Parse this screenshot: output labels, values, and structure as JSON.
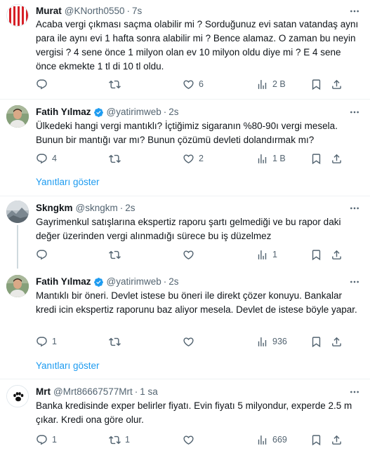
{
  "tweets": [
    {
      "name": "Murat",
      "handle": "@KNorth0550",
      "time": "7s",
      "verified": false,
      "text": "Acaba vergi çıkması saçma olabilir mi ? Sorduğunuz evi satan vatandaş aynı para ile aynı evi 1 hafta sonra alabilir mi ? Bence alamaz. O zaman bu neyin vergisi ? 4 sene önce 1 milyon olan ev 10 milyon oldu diye mi ? E 4 sene önce ekmekte 1 tl di 10 tl oldu.",
      "replies": "",
      "retweets": "",
      "likes": "6",
      "views": "2 B"
    },
    {
      "name": "Fatih Yılmaz",
      "handle": "@yatirimweb",
      "time": "2s",
      "verified": true,
      "text": "Ülkedeki hangi vergi mantıklı? İçtiğimiz sigaranın %80-90ı vergi mesela. Bunun bir mantığı var mı? Bunun çözümü devleti dolandırmak mı?",
      "replies": "4",
      "retweets": "",
      "likes": "2",
      "views": "1 B"
    },
    {
      "name": "Skngkm",
      "handle": "@skngkm",
      "time": "2s",
      "verified": false,
      "text": "Gayrimenkul satışlarına ekspertiz raporu şartı gelmediği ve bu rapor daki değer üzerinden vergi alınmadığı sürece bu iş düzelmez",
      "replies": "",
      "retweets": "",
      "likes": "",
      "views": "1"
    },
    {
      "name": "Fatih Yılmaz",
      "handle": "@yatirimweb",
      "time": "2s",
      "verified": true,
      "text": "Mantıklı bir öneri. Devlet istese bu öneri ile direkt çözer konuyu. Bankalar kredi icin ekspertiz raporunu baz aliyor mesela. Devlet de istese böyle yapar.",
      "replies": "1",
      "retweets": "",
      "likes": "",
      "views": "936"
    },
    {
      "name": "Mrt",
      "handle": "@Mrt86667577Mrt",
      "time": "1 sa",
      "verified": false,
      "text": "Banka kredisinde exper belirler fiyatı. Evin fiyatı 5 milyondur, experde 2.5 m çıkar. Kredi ona göre olur.",
      "replies": "1",
      "retweets": "1",
      "likes": "",
      "views": "669"
    }
  ],
  "show_replies_label": "Yanıtları göster",
  "colors": {
    "accent": "#1d9bf0",
    "muted": "#536471",
    "divider": "#eff3f4"
  },
  "icons": [
    "more-icon",
    "reply-icon",
    "retweet-icon",
    "like-icon",
    "views-icon",
    "bookmark-icon",
    "share-icon",
    "verified-icon"
  ]
}
